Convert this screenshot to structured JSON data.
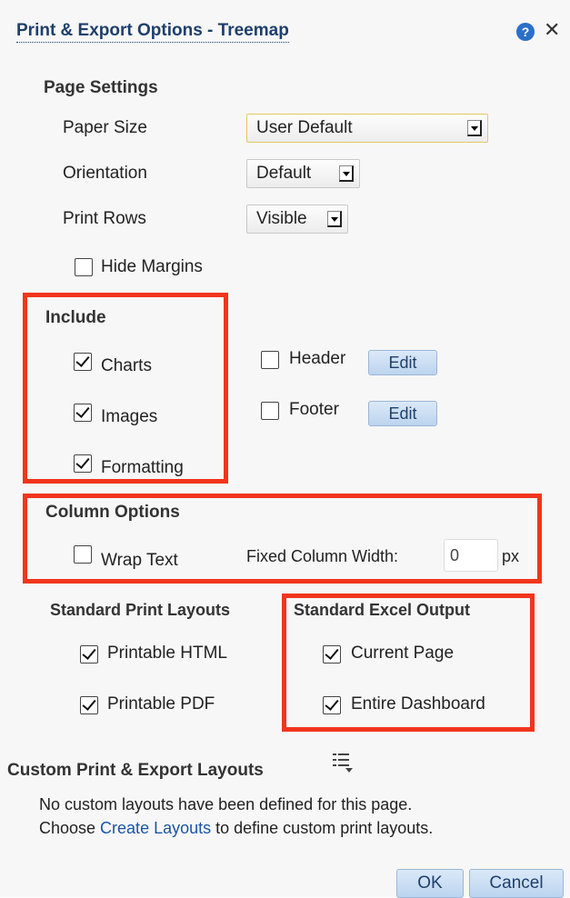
{
  "dialog": {
    "title": "Print & Export Options - Treemap",
    "help_glyph": "?",
    "close_glyph": "✕"
  },
  "page_settings": {
    "heading": "Page Settings",
    "paper_size": {
      "label": "Paper Size",
      "value": "User Default"
    },
    "orientation": {
      "label": "Orientation",
      "value": "Default"
    },
    "print_rows": {
      "label": "Print Rows",
      "value": "Visible"
    },
    "hide_margins": {
      "label": "Hide Margins",
      "checked": false
    }
  },
  "include": {
    "heading": "Include",
    "charts": {
      "label": "Charts",
      "checked": true
    },
    "images": {
      "label": "Images",
      "checked": true
    },
    "formatting": {
      "label": "Formatting",
      "checked": true
    },
    "header": {
      "label": "Header",
      "checked": false,
      "edit_label": "Edit"
    },
    "footer": {
      "label": "Footer",
      "checked": false,
      "edit_label": "Edit"
    }
  },
  "column_options": {
    "heading": "Column Options",
    "wrap_text": {
      "label": "Wrap Text",
      "checked": false
    },
    "fixed_width": {
      "label": "Fixed Column Width:",
      "value": "0",
      "unit": "px"
    }
  },
  "print_layouts": {
    "heading": "Standard Print Layouts",
    "html": {
      "label": "Printable HTML",
      "checked": true
    },
    "pdf": {
      "label": "Printable PDF",
      "checked": true
    }
  },
  "excel_output": {
    "heading": "Standard Excel Output",
    "current_page": {
      "label": "Current Page",
      "checked": true
    },
    "entire_dashboard": {
      "label": "Entire Dashboard",
      "checked": true
    }
  },
  "custom_layouts": {
    "heading": "Custom Print & Export Layouts",
    "line1": "No custom layouts have been defined for this page.",
    "line2_prefix": "Choose ",
    "link": "Create Layouts",
    "line2_suffix": " to define custom print layouts."
  },
  "footer_buttons": {
    "ok": "OK",
    "cancel": "Cancel"
  },
  "colors": {
    "highlight": "#f2351c",
    "title": "#1f3f6b",
    "link": "#1a55a6"
  }
}
